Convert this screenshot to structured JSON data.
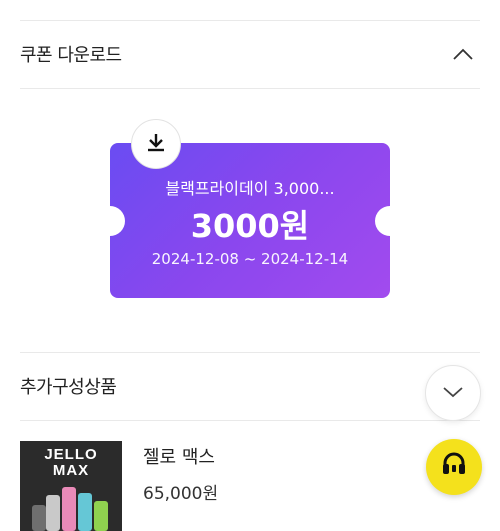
{
  "coupon_section": {
    "title": "쿠폰 다운로드",
    "coupon": {
      "name": "블랙프라이데이 3,000...",
      "amount": "3000원",
      "dates": "2024-12-08 ~ 2024-12-14"
    }
  },
  "addon_section": {
    "title": "추가구성상품",
    "products": [
      {
        "thumb_line1": "JELLO",
        "thumb_line2": "MAX",
        "name": "젤로 맥스",
        "price": "65,000원"
      }
    ]
  },
  "icons": {
    "collapse": "chevron-up-icon",
    "download": "download-icon",
    "scroll": "chevron-down-icon",
    "support": "headset-icon"
  },
  "colors": {
    "coupon_gradient_start": "#6a4cf2",
    "coupon_gradient_end": "#a24bee",
    "support_button": "#f4e11c"
  }
}
